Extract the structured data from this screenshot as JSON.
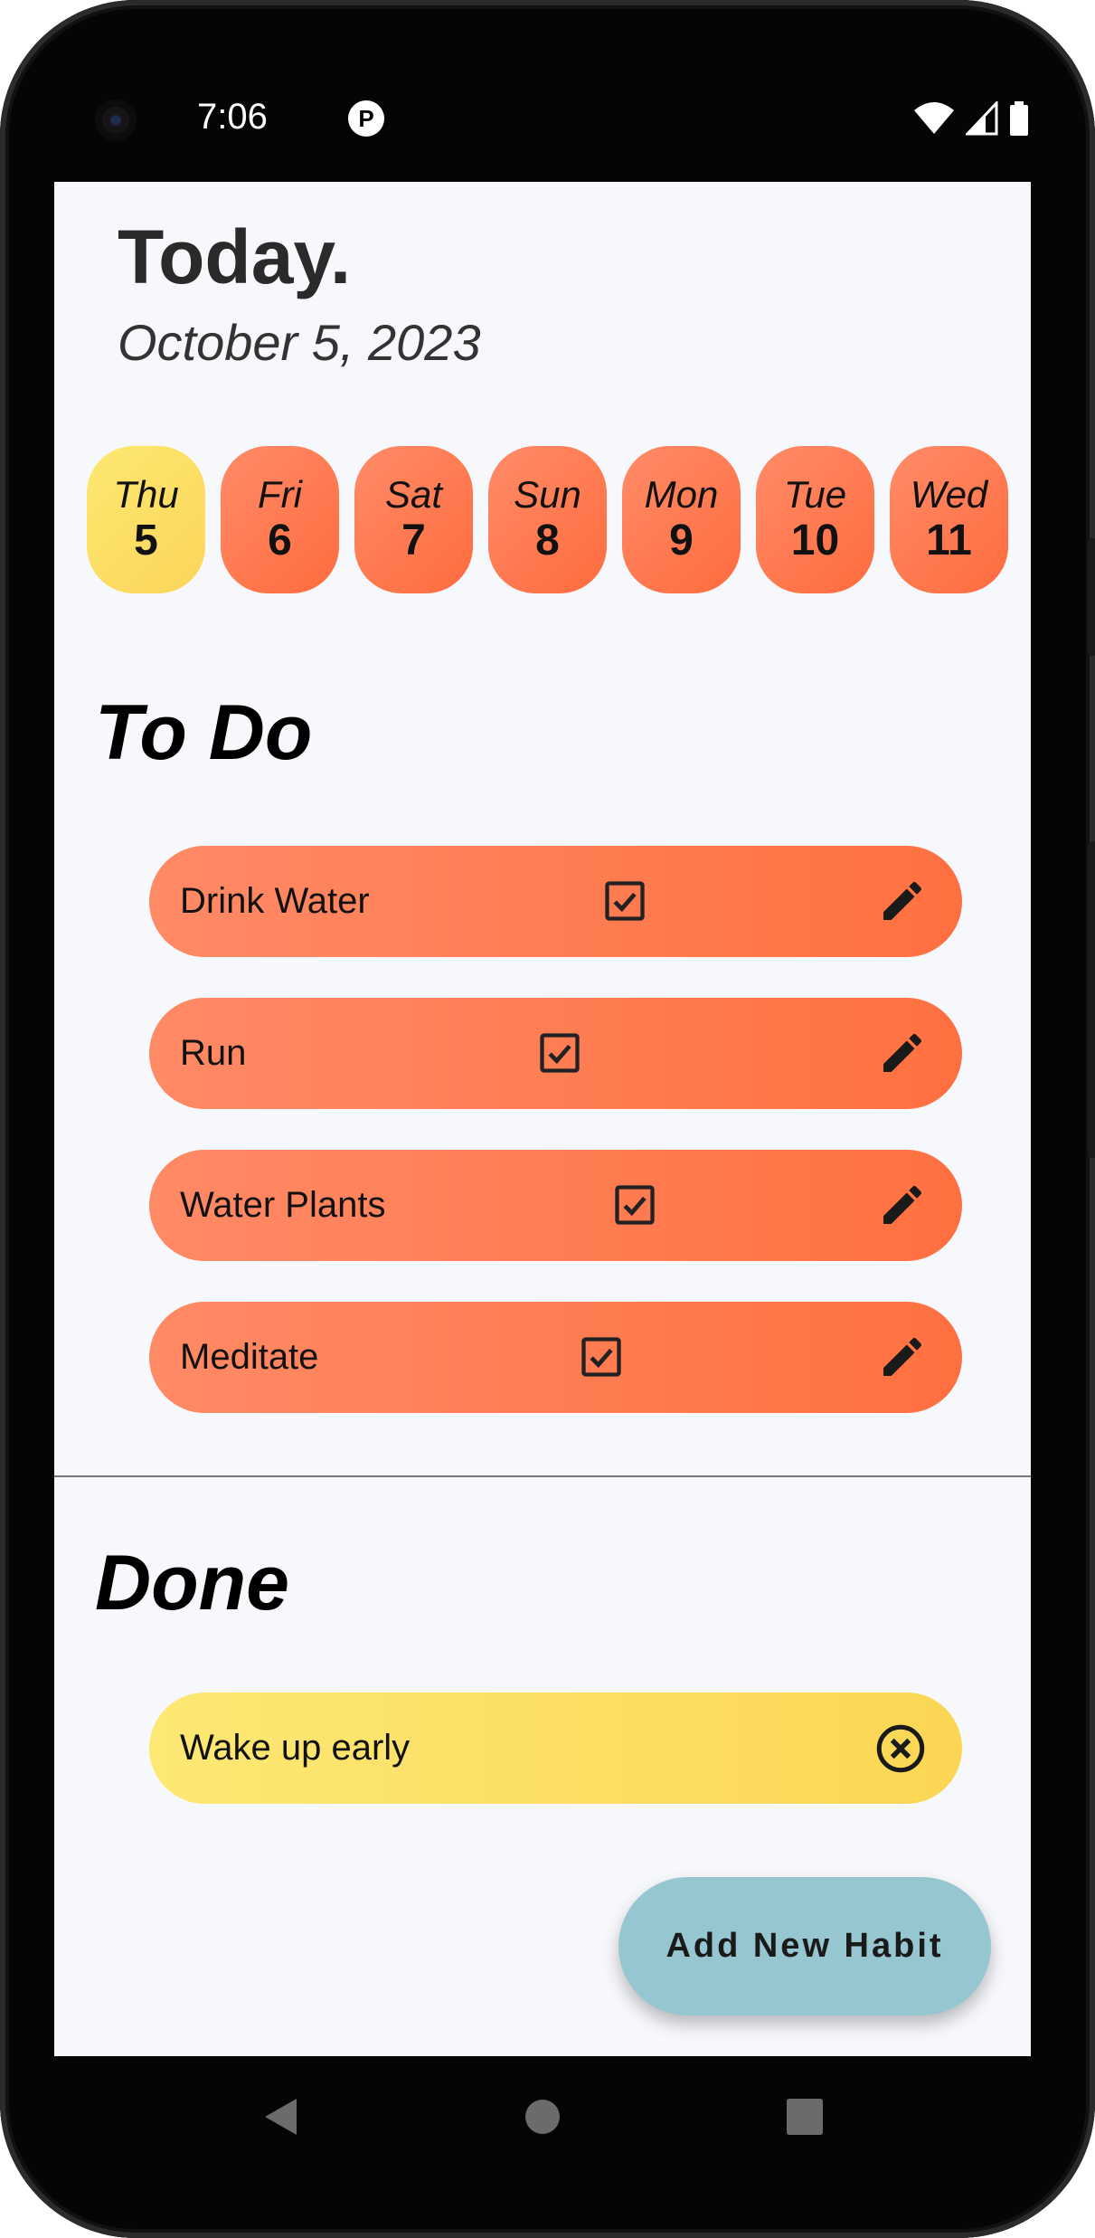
{
  "status": {
    "time": "7:06"
  },
  "header": {
    "title": "Today.",
    "date": "October 5, 2023"
  },
  "days": [
    {
      "name": "Thu",
      "num": "5",
      "selected": true
    },
    {
      "name": "Fri",
      "num": "6"
    },
    {
      "name": "Sat",
      "num": "7"
    },
    {
      "name": "Sun",
      "num": "8"
    },
    {
      "name": "Mon",
      "num": "9"
    },
    {
      "name": "Tue",
      "num": "10"
    },
    {
      "name": "Wed",
      "num": "11"
    }
  ],
  "todo": {
    "title": "To Do",
    "items": [
      {
        "name": "Drink Water"
      },
      {
        "name": "Run"
      },
      {
        "name": "Water Plants"
      },
      {
        "name": "Meditate"
      }
    ]
  },
  "done": {
    "title": "Done",
    "items": [
      {
        "name": "Wake up early"
      }
    ]
  },
  "fab": {
    "label": "Add New Habit"
  },
  "icons": {
    "todo_item": [
      "checkbox-icon",
      "edit-pencil-icon"
    ],
    "done_item": [
      "cancel-circle-icon"
    ],
    "nav": [
      "back-icon",
      "home-icon",
      "recents-icon"
    ]
  },
  "colors": {
    "accent_orange": "#ff7a4d",
    "accent_yellow": "#fcdc60",
    "fab": "#96c6d0",
    "background": "#f7f8fc"
  }
}
